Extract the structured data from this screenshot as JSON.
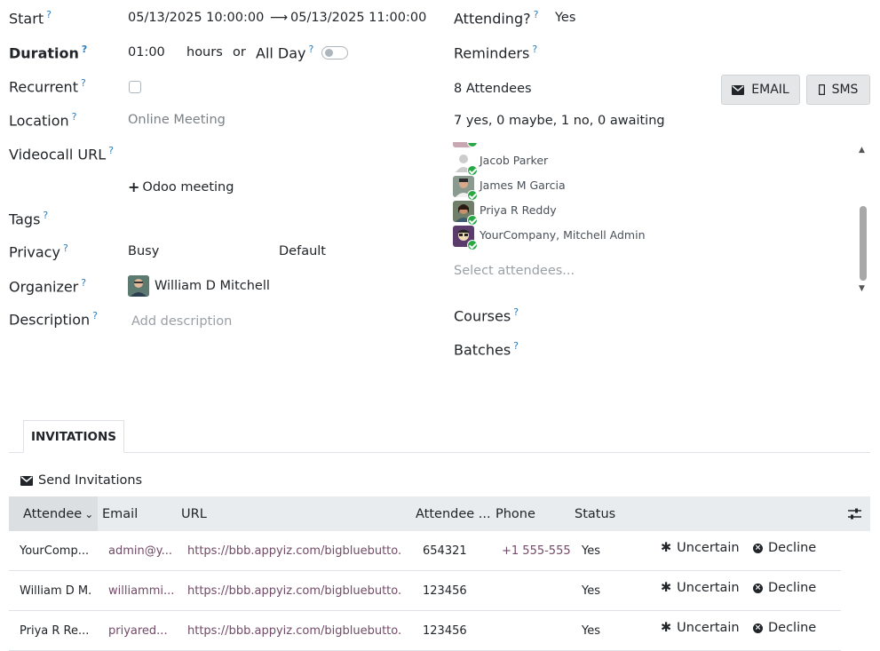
{
  "left": {
    "start": {
      "label": "Start",
      "from": "05/13/2025 10:00:00",
      "to": "05/13/2025 11:00:00"
    },
    "duration": {
      "label": "Duration",
      "value": "01:00",
      "unit": "hours",
      "or": "or",
      "allday_label": "All Day"
    },
    "recurrent": {
      "label": "Recurrent"
    },
    "location": {
      "label": "Location",
      "value": "Online Meeting"
    },
    "videocall": {
      "label": "Videocall URL",
      "button": "Odoo meeting"
    },
    "tags": {
      "label": "Tags"
    },
    "privacy": {
      "label": "Privacy",
      "show_as": "Busy",
      "privacy": "Default"
    },
    "organizer": {
      "label": "Organizer",
      "name": "William D Mitchell"
    },
    "description": {
      "label": "Description",
      "placeholder": "Add description"
    }
  },
  "right": {
    "attending": {
      "label": "Attending?",
      "value": "Yes"
    },
    "reminders": {
      "label": "Reminders"
    },
    "attendees_count": "8 Attendees",
    "email_button": "EMAIL",
    "sms_button": "SMS",
    "summary": "7 yes, 0 maybe, 1 no, 0 awaiting",
    "attendees": [
      {
        "name": "Jacob Parker"
      },
      {
        "name": "James M Garcia"
      },
      {
        "name": "Priya R Reddy"
      },
      {
        "name": "YourCompany, Mitchell Admin"
      }
    ],
    "select_placeholder": "Select attendees...",
    "courses": {
      "label": "Courses"
    },
    "batches": {
      "label": "Batches"
    }
  },
  "tabs": {
    "invitations": "INVITATIONS"
  },
  "send_invitations": "Send Invitations",
  "table": {
    "columns": [
      "Attendee",
      "Email",
      "URL",
      "Attendee ...",
      "Phone",
      "Status"
    ],
    "rows": [
      {
        "attendee": "YourComp...",
        "email": "admin@y...",
        "url": "https://bbb.appyiz.com/bigbluebutto...",
        "code": "654321",
        "phone": "+1 555-555-",
        "status": "Yes"
      },
      {
        "attendee": "William D M...",
        "email": "williammi...",
        "url": "https://bbb.appyiz.com/bigbluebutto...",
        "code": "123456",
        "phone": "",
        "status": "Yes"
      },
      {
        "attendee": "Priya R Re...",
        "email": "priyared...",
        "url": "https://bbb.appyiz.com/bigbluebutto...",
        "code": "123456",
        "phone": "",
        "status": "Yes"
      }
    ],
    "uncertain": "Uncertain",
    "decline": "Decline"
  },
  "help_mark": "?"
}
